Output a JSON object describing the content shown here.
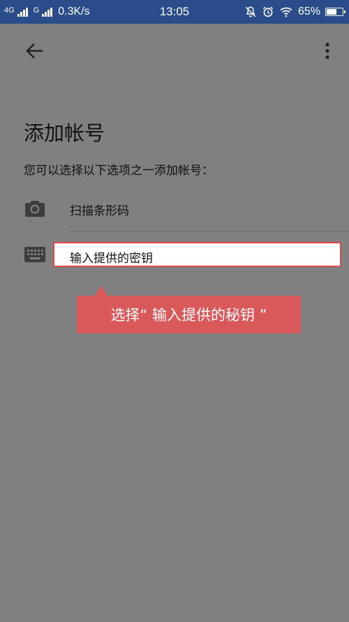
{
  "status_bar": {
    "network_1": "4G",
    "network_2": "G",
    "speed": "0.3K/s",
    "time": "13:05",
    "battery": "65%",
    "battery_level": 0.65
  },
  "header": {
    "back_icon": "arrow-left-icon",
    "menu_icon": "more-vert-icon"
  },
  "page": {
    "title": "添加帐号",
    "subtitle": "您可以选择以下选项之一添加帐号："
  },
  "options": [
    {
      "icon": "camera-icon",
      "label": "扫描条形码"
    },
    {
      "icon": "keyboard-icon",
      "label": "输入提供的密钥"
    }
  ],
  "annotation": {
    "text": "选择“ 输入提供的秘钥 ”"
  },
  "colors": {
    "status_bar": "#2a4c8a",
    "overlay": "#808080",
    "highlight": "#e0474c",
    "callout": "#d9585a"
  }
}
